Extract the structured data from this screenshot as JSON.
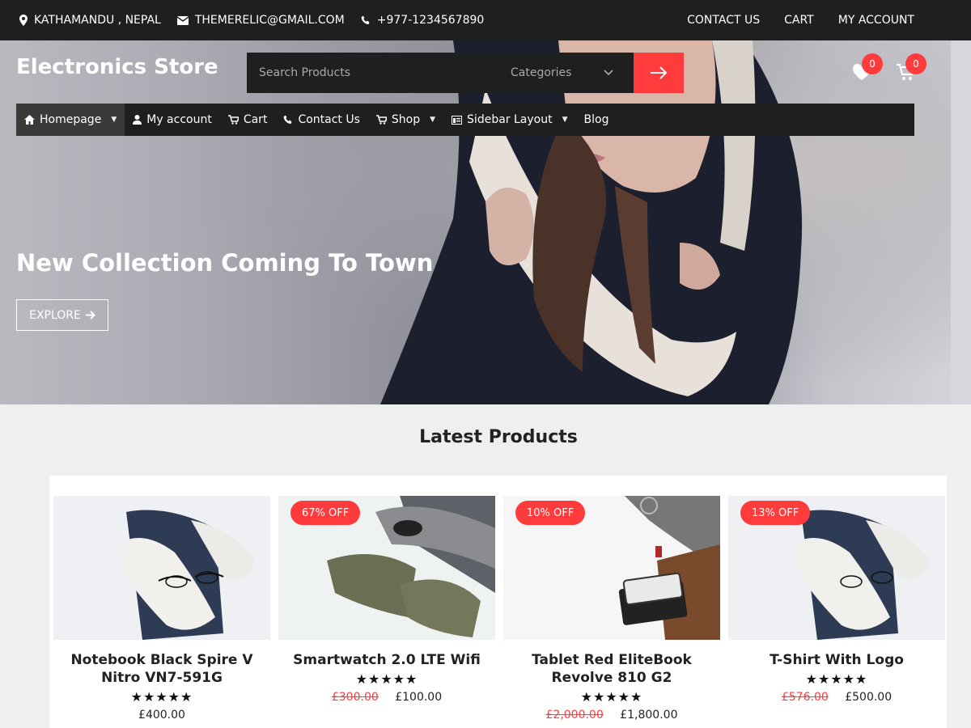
{
  "topbar": {
    "location": "KATHAMANDU , NEPAL",
    "email": "THEMERELIC@GMAIL.COM",
    "phone": "+977-1234567890",
    "links": [
      "CONTACT US",
      "CART",
      "MY ACCOUNT"
    ]
  },
  "header": {
    "site_title": "Electronics Store",
    "search_placeholder": "Search Products",
    "categories_label": "Categories",
    "wishlist_count": "0",
    "cart_count": "0"
  },
  "nav": {
    "items": [
      {
        "label": "Homepage",
        "icon": "home-icon",
        "dropdown": true
      },
      {
        "label": "My account",
        "icon": "user-icon",
        "dropdown": false
      },
      {
        "label": "Cart",
        "icon": "cart-icon",
        "dropdown": false
      },
      {
        "label": "Contact Us",
        "icon": "phone-icon",
        "dropdown": false
      },
      {
        "label": "Shop",
        "icon": "cart-icon",
        "dropdown": true
      },
      {
        "label": "Sidebar Layout",
        "icon": "layout-icon",
        "dropdown": true
      },
      {
        "label": "Blog",
        "icon": "",
        "dropdown": false
      }
    ]
  },
  "hero": {
    "title": "New Collection Coming To Town",
    "button": "EXPLORE"
  },
  "products_section": {
    "title": "Latest Products",
    "items": [
      {
        "name": "Notebook Black Spire V Nitro VN7-591G",
        "badge": "",
        "old_price": "",
        "price": "£400.00",
        "stars": "★★★★★"
      },
      {
        "name": "Smartwatch 2.0 LTE Wifi",
        "badge": "67% OFF",
        "old_price": "£300.00",
        "price": "£100.00",
        "stars": "★★★★★"
      },
      {
        "name": "Tablet Red EliteBook Revolve 810 G2",
        "badge": "10% OFF",
        "old_price": "£2,000.00",
        "price": "£1,800.00",
        "stars": "★★★★★"
      },
      {
        "name": "T-Shirt With Logo",
        "badge": "13% OFF",
        "old_price": "£576.00",
        "price": "£500.00",
        "stars": "★★★★★"
      }
    ]
  },
  "colors": {
    "accent": "#ff3b3b",
    "dark": "#1f1f1f"
  }
}
